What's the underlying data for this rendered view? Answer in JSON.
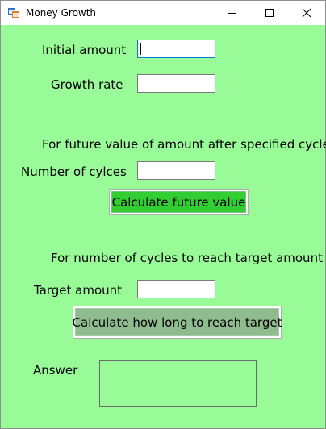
{
  "window": {
    "title": "Money Growth",
    "icon": "winforms-app-icon",
    "controls": {
      "minimize_icon": "minimize-icon",
      "maximize_icon": "maximize-icon",
      "close_icon": "close-icon"
    }
  },
  "colors": {
    "form_background": "#98FB98",
    "future_button_background": "#32CD32",
    "target_button_background": "#8FBC8F"
  },
  "form": {
    "initial_amount": {
      "label": "Initial amount",
      "value": "",
      "focused": true
    },
    "growth_rate": {
      "label": "Growth rate",
      "value": ""
    },
    "future_section_heading": "For future value of amount after specified cycles",
    "number_of_cycles": {
      "label": "Number of cylces",
      "value": ""
    },
    "calculate_future_button": "Calculate future value",
    "target_section_heading": "For number of cycles to reach target amount",
    "target_amount": {
      "label": "Target amount",
      "value": ""
    },
    "calculate_target_button": "Calculate how long to reach target",
    "answer": {
      "label": "Answer",
      "value": ""
    }
  }
}
